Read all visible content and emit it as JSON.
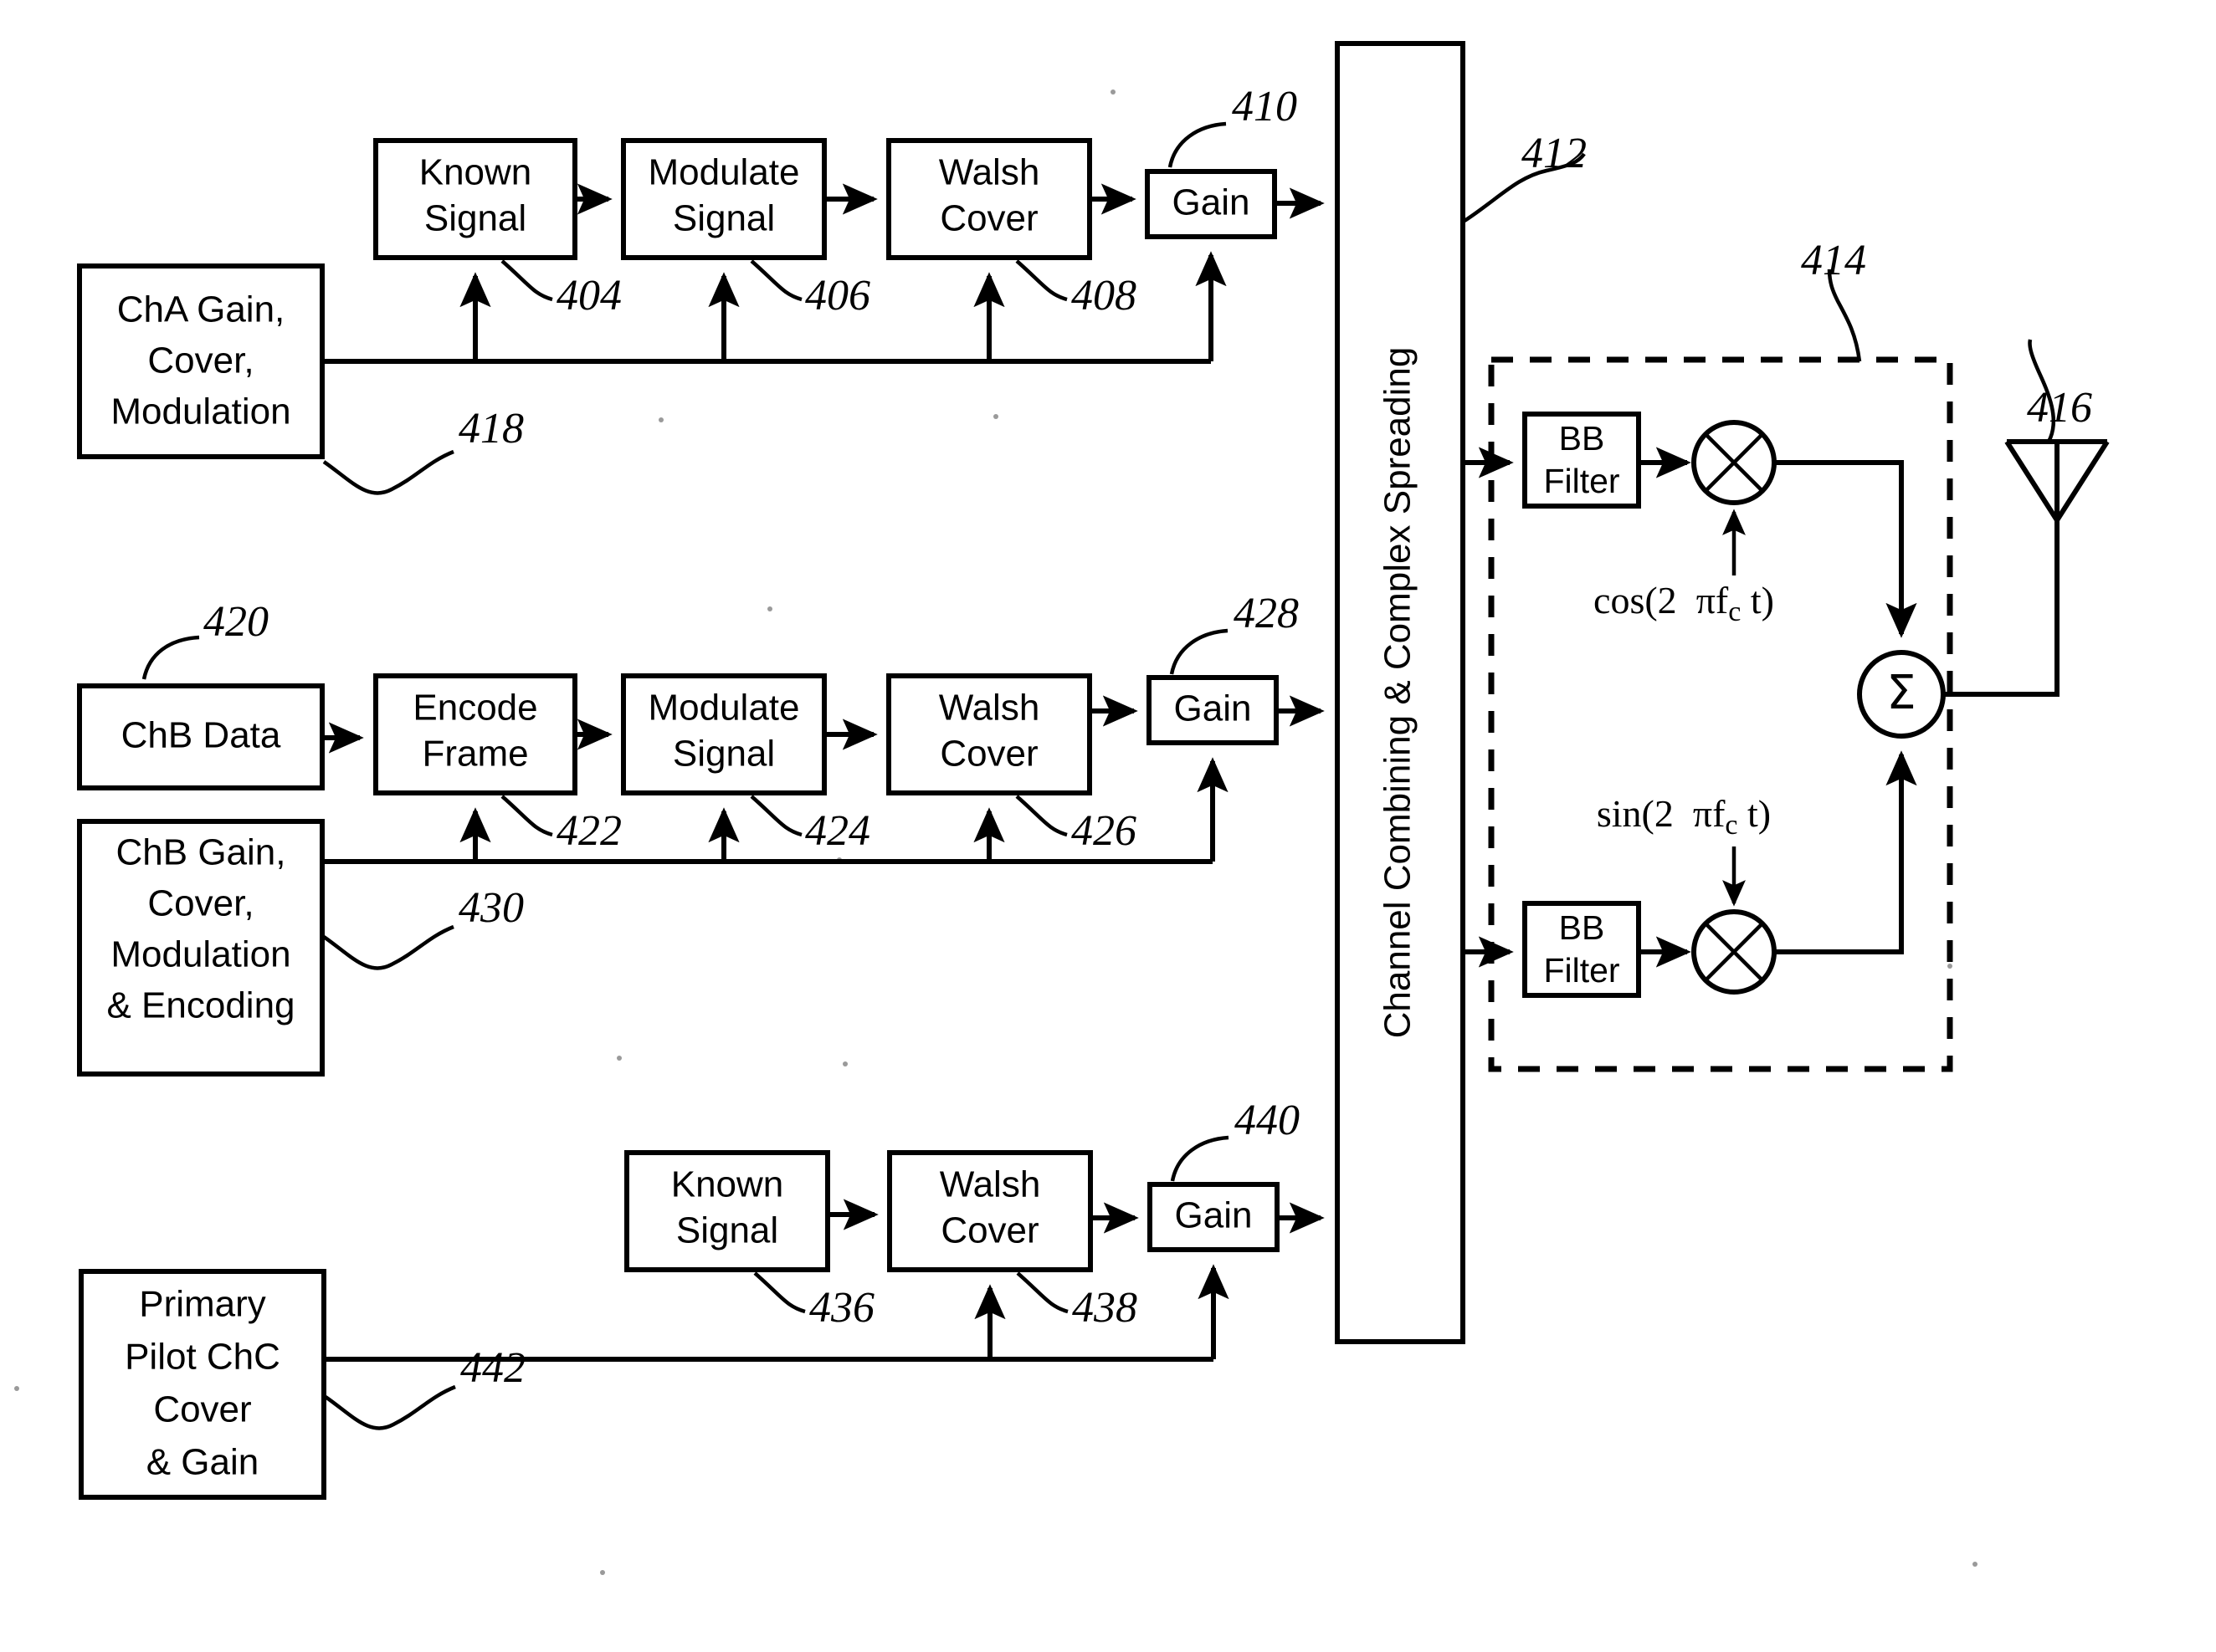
{
  "figure": {
    "title": "CDMA Transmitter Block Diagram",
    "blocks": {
      "cha_known_signal": "Known\nSignal",
      "cha_known_signal_l1": "Known",
      "cha_known_signal_l2": "Signal",
      "cha_modulate_l1": "Modulate",
      "cha_modulate_l2": "Signal",
      "cha_walsh_l1": "Walsh",
      "cha_walsh_l2": "Cover",
      "cha_gain": "Gain",
      "cha_params_l1": "ChA Gain,",
      "cha_params_l2": "Cover,",
      "cha_params_l3": "Modulation",
      "chb_data": "ChB Data",
      "chb_encode_l1": "Encode",
      "chb_encode_l2": "Frame",
      "chb_modulate_l1": "Modulate",
      "chb_modulate_l2": "Signal",
      "chb_walsh_l1": "Walsh",
      "chb_walsh_l2": "Cover",
      "chb_gain": "Gain",
      "chb_params_l1": "ChB Gain,",
      "chb_params_l2": "Cover,",
      "chb_params_l3": "Modulation",
      "chb_params_l4": "& Encoding",
      "chc_known_signal_l1": "Known",
      "chc_known_signal_l2": "Signal",
      "chc_walsh_l1": "Walsh",
      "chc_walsh_l2": "Cover",
      "chc_gain": "Gain",
      "chc_params_l1": "Primary",
      "chc_params_l2": "Pilot ChC",
      "chc_params_l3": "Cover",
      "chc_params_l4": "& Gain",
      "combiner": "Channel Combining & Complex Spreading",
      "bb_filter_i_l1": "BB",
      "bb_filter_i_l2": "Filter",
      "bb_filter_q_l1": "BB",
      "bb_filter_q_l2": "Filter",
      "summer": "Σ"
    },
    "carriers": {
      "cos_prefix": "cos(2",
      "cos_pi": "π",
      "cos_f": "f",
      "cos_sub": "c",
      "cos_suffix": "t)",
      "sin_prefix": "sin(2",
      "sin_pi": "π",
      "sin_f": "f",
      "sin_sub": "c",
      "sin_suffix": "t)"
    },
    "reference_numerals": {
      "n404": "404",
      "n406": "406",
      "n408": "408",
      "n410": "410",
      "n412": "412",
      "n414": "414",
      "n416": "416",
      "n418": "418",
      "n420": "420",
      "n422": "422",
      "n424": "424",
      "n426": "426",
      "n428": "428",
      "n430": "430",
      "n436": "436",
      "n438": "438",
      "n440": "440",
      "n442": "442"
    },
    "colors": {
      "ink": "#000000",
      "paper": "#ffffff"
    }
  }
}
